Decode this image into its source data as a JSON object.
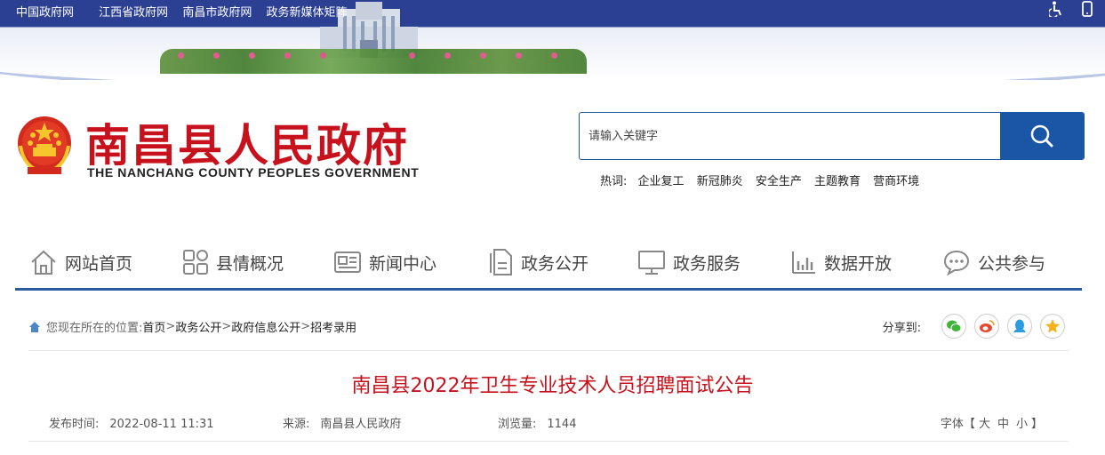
{
  "top_links": [
    "中国政府网",
    "江西省政府网",
    "南昌市政府网",
    "政务新媒体矩阵"
  ],
  "top_icons": [
    "accessibility-icon",
    "mobile-icon"
  ],
  "site": {
    "title": "南昌县人民政府",
    "subtitle": "THE NANCHANG COUNTY PEOPLES GOVERNMENT"
  },
  "search": {
    "placeholder": "请输入关键字"
  },
  "hot": {
    "label": "热词:",
    "words": [
      "企业复工",
      "新冠肺炎",
      "安全生产",
      "主题教育",
      "营商环境"
    ]
  },
  "nav": [
    {
      "label": "网站首页",
      "icon": "home-icon"
    },
    {
      "label": "县情概况",
      "icon": "grid-icon"
    },
    {
      "label": "新闻中心",
      "icon": "news-icon"
    },
    {
      "label": "政务公开",
      "icon": "document-icon"
    },
    {
      "label": "政务服务",
      "icon": "monitor-icon"
    },
    {
      "label": "数据开放",
      "icon": "bar-chart-icon"
    },
    {
      "label": "公共参与",
      "icon": "chat-icon"
    }
  ],
  "breadcrumb": {
    "prefix": "您现在所在的位置:",
    "items": [
      "首页",
      "政务公开",
      "政府信息公开",
      "招考录用"
    ],
    "sep": ">"
  },
  "share": {
    "label": "分享到:",
    "icons": [
      "wechat-icon",
      "weibo-icon",
      "qq-icon",
      "qzone-icon"
    ]
  },
  "article": {
    "title": "南昌县2022年卫生专业技术人员招聘面试公告",
    "publish_label": "发布时间:",
    "publish_time": "2022-08-11 11:31",
    "source_label": "来源:",
    "source": "南昌县人民政府",
    "views_label": "浏览量:",
    "views": "1144"
  },
  "font_size": {
    "label": "字体【",
    "large": "大",
    "medium": "中",
    "small": "小",
    "close": "】"
  },
  "colors": {
    "brand_red": "#c7121d",
    "brand_blue": "#1a56a5",
    "nav_line": "#2d5aa3"
  }
}
